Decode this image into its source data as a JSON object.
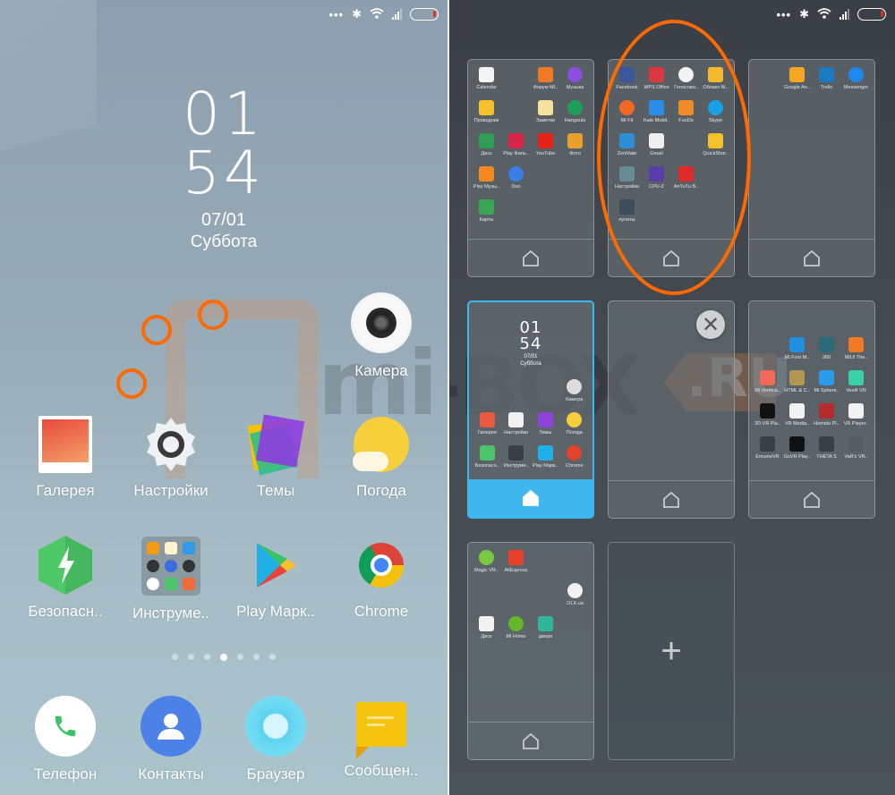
{
  "status_bar": {
    "icons": [
      "dots-icon",
      "bluetooth-icon",
      "wifi-icon",
      "signal-icon",
      "battery-icon"
    ],
    "dots": "•••",
    "bluetooth": "✱"
  },
  "home_screen": {
    "clock": {
      "hour": "01",
      "minute": "54",
      "date": "07/01",
      "day": "Суббота"
    },
    "watermark": "mi-BOX.RU",
    "apps": [
      {
        "name": "camera",
        "label": "Камера",
        "icon": "camera-icon"
      },
      {
        "name": "gallery",
        "label": "Галерея",
        "icon": "gallery-icon"
      },
      {
        "name": "settings",
        "label": "Настройки",
        "icon": "gear-icon"
      },
      {
        "name": "themes",
        "label": "Темы",
        "icon": "themes-icon"
      },
      {
        "name": "weather",
        "label": "Погода",
        "icon": "weather-icon"
      },
      {
        "name": "security",
        "label": "Безопасн..",
        "icon": "security-icon"
      },
      {
        "name": "tools-folder",
        "label": "Инструме..",
        "icon": "folder-icon"
      },
      {
        "name": "play-market",
        "label": "Play Марк..",
        "icon": "play-store-icon"
      },
      {
        "name": "chrome",
        "label": "Chrome",
        "icon": "chrome-icon"
      }
    ],
    "page_indicator": {
      "total": 7,
      "current": 4
    },
    "dock": [
      {
        "name": "phone",
        "label": "Телефон",
        "icon": "phone-icon"
      },
      {
        "name": "contacts",
        "label": "Контакты",
        "icon": "contacts-icon"
      },
      {
        "name": "browser",
        "label": "Браузер",
        "icon": "browser-icon"
      },
      {
        "name": "messages",
        "label": "Сообщен..",
        "icon": "messages-icon"
      }
    ]
  },
  "edit_screen": {
    "pages": [
      {
        "apps": [
          {
            "label": "Calendar",
            "color": "#f4f4f4"
          },
          {
            "label": "",
            "color": ""
          },
          {
            "label": "Форум MI..",
            "color": "#f07a23"
          },
          {
            "label": "Музыка",
            "color": "#8a4fe0"
          },
          {
            "label": "Проводник",
            "color": "#f6c12b"
          },
          {
            "label": "",
            "color": ""
          },
          {
            "label": "Заметки",
            "color": "#f4e29a"
          },
          {
            "label": "Hangouts",
            "color": "#1e9e58"
          },
          {
            "label": "Диск",
            "color": "#2f9d55"
          },
          {
            "label": "Play Филь..",
            "color": "#d8254a"
          },
          {
            "label": "YouTube",
            "color": "#e62117"
          },
          {
            "label": "Фото",
            "color": "#e7a02b"
          },
          {
            "label": "Play Музы..",
            "color": "#f48a1f"
          },
          {
            "label": "Duo",
            "color": "#3c7ee8"
          },
          {
            "label": "",
            "color": ""
          },
          {
            "label": "",
            "color": ""
          },
          {
            "label": "Карты",
            "color": "#3aa757"
          }
        ]
      },
      {
        "apps": [
          {
            "label": "Facebook",
            "color": "#3b5998"
          },
          {
            "label": "WPS Office",
            "color": "#d7393f"
          },
          {
            "label": "Голосово..",
            "color": "#f2f2f2"
          },
          {
            "label": "Облако M..",
            "color": "#f3b82e"
          },
          {
            "label": "Mi Fit",
            "color": "#f06a23"
          },
          {
            "label": "Kate Mobil..",
            "color": "#2a8ee8"
          },
          {
            "label": "FunDo",
            "color": "#f08b2a"
          },
          {
            "label": "Skype",
            "color": "#1aa0e6"
          },
          {
            "label": "ZenMate",
            "color": "#2d8fd1"
          },
          {
            "label": "Gmail",
            "color": "#efefef"
          },
          {
            "label": "",
            "color": ""
          },
          {
            "label": "QuickShor..",
            "color": "#f5c12a"
          },
          {
            "label": "Настройки",
            "color": "#6a8a96"
          },
          {
            "label": "CPU-Z",
            "color": "#5a3ea8"
          },
          {
            "label": "AnTuTu B..",
            "color": "#e02a2a"
          },
          {
            "label": "",
            "color": ""
          },
          {
            "label": "пупаты",
            "color": "#3c4d5c"
          }
        ]
      },
      {
        "apps": [
          {
            "label": "",
            "color": ""
          },
          {
            "label": "Google An..",
            "color": "#f2a621"
          },
          {
            "label": "Trello",
            "color": "#1b79bf"
          },
          {
            "label": "Messenger",
            "color": "#1e87f0"
          }
        ]
      },
      {
        "active": true,
        "mini_clock": {
          "hour": "01",
          "minute": "54",
          "date": "07/01",
          "day": "Суббота"
        },
        "apps": [
          {
            "label": "Камера",
            "color": "#dcdcdc"
          },
          {
            "label": "Галерея",
            "color": "#ec5a3e"
          },
          {
            "label": "Настройки",
            "color": "#f2f2f2"
          },
          {
            "label": "Темы",
            "color": "#8e44d8"
          },
          {
            "label": "Погода",
            "color": "#f6cf3b"
          },
          {
            "label": "Безопасн..",
            "color": "#4cc56a"
          },
          {
            "label": "Инструме..",
            "color": "#3a3f45"
          },
          {
            "label": "Play Марк..",
            "color": "#1fb0e8"
          },
          {
            "label": "Chrome",
            "color": "#e0442c"
          }
        ]
      },
      {
        "empty": true,
        "close_label": "✕"
      },
      {
        "apps": [
          {
            "label": "",
            "color": ""
          },
          {
            "label": "Mi Font M..",
            "color": "#1f8fe0"
          },
          {
            "label": "360",
            "color": "#2a6a7a"
          },
          {
            "label": "MIUI The..",
            "color": "#f07a23"
          },
          {
            "label": "Mi Verifica..",
            "color": "#f06a5a"
          },
          {
            "label": "HTML & C..",
            "color": "#b39650"
          },
          {
            "label": "Mi Sphere..",
            "color": "#2a9be8"
          },
          {
            "label": "VeeR VR",
            "color": "#3ad2a4"
          },
          {
            "label": "3D VR Pla..",
            "color": "#111111"
          },
          {
            "label": "VR Media..",
            "color": "#f2f2f2"
          },
          {
            "label": "Homido Pl..",
            "color": "#b52a2a"
          },
          {
            "label": "VR Player..",
            "color": "#f2f2f2"
          },
          {
            "label": "EmumeVR",
            "color": "#3a3f45"
          },
          {
            "label": "GoVR Play..",
            "color": "#111111"
          },
          {
            "label": "THETA S",
            "color": "#3a3f45"
          },
          {
            "label": "VaR's VR..",
            "color": "#555d63"
          }
        ]
      },
      {
        "apps": [
          {
            "label": "Magic VR..",
            "color": "#7ac943"
          },
          {
            "label": "AliExpress",
            "color": "#e8402a"
          },
          {
            "label": "",
            "color": ""
          },
          {
            "label": "",
            "color": ""
          },
          {
            "label": "",
            "color": ""
          },
          {
            "label": "",
            "color": ""
          },
          {
            "label": "",
            "color": ""
          },
          {
            "label": "OLX.ua",
            "color": "#f2f2f2"
          },
          {
            "label": "Диск",
            "color": "#f2f2f2"
          },
          {
            "label": "Mi Home",
            "color": "#62b82a"
          },
          {
            "label": "двери",
            "color": "#2fb59a"
          }
        ]
      },
      {
        "add_page": true,
        "add_label": "+"
      }
    ]
  }
}
